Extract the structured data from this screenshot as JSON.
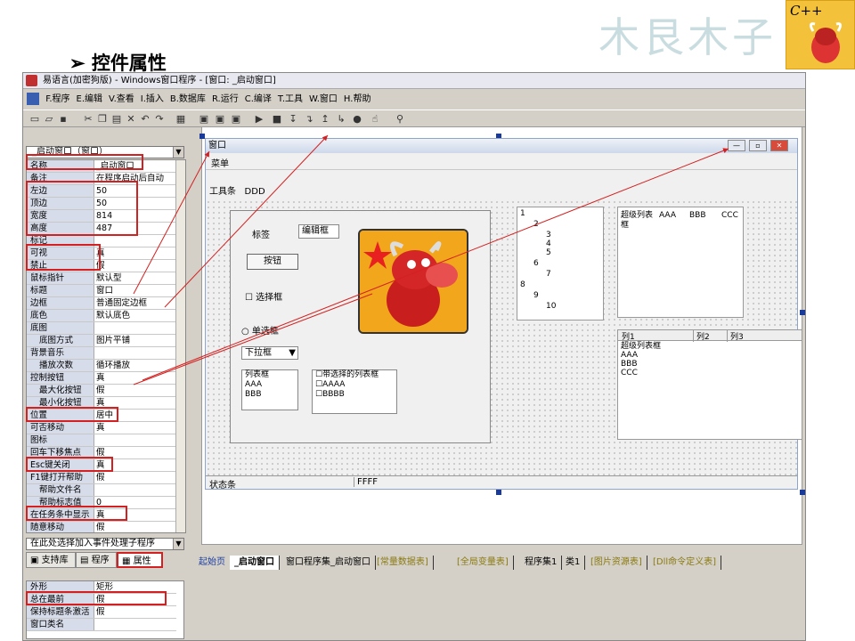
{
  "slide": {
    "bullet": "➢",
    "title": "控件属性",
    "brand": "木艮木子",
    "logo_text": "C++"
  },
  "app": {
    "title": "易语言(加密狗版) - Windows窗口程序 - [窗口: _启动窗口]",
    "menu": [
      "F.程序",
      "E.编辑",
      "V.查看",
      "I.插入",
      "B.数据库",
      "R.运行",
      "C.编译",
      "T.工具",
      "W.窗口",
      "H.帮助"
    ],
    "toolbar_icons": [
      "new-icon",
      "open-icon",
      "save-icon",
      "cut-icon",
      "copy-icon",
      "paste-icon",
      "delete-icon",
      "undo-icon",
      "redo-icon",
      "find-icon",
      "layout1-icon",
      "layout2-icon",
      "layout3-icon",
      "run-icon",
      "stop-icon",
      "step-icon",
      "step-into-icon",
      "step-out-icon",
      "run-to-icon",
      "breakpoint-icon",
      "hand-icon",
      "binoculars-icon"
    ]
  },
  "props": {
    "selector": "_启动窗口（窗口）",
    "rows": [
      {
        "k": "名称",
        "v": "_启动窗口"
      },
      {
        "k": "备注",
        "v": "在程序启动后自动"
      },
      {
        "k": "左边",
        "v": "50"
      },
      {
        "k": "顶边",
        "v": "50"
      },
      {
        "k": "宽度",
        "v": "814"
      },
      {
        "k": "高度",
        "v": "487"
      },
      {
        "k": "标记",
        "v": ""
      },
      {
        "k": "可视",
        "v": "真"
      },
      {
        "k": "禁止",
        "v": "假"
      },
      {
        "k": "鼠标指针",
        "v": "默认型"
      },
      {
        "k": "标题",
        "v": "窗口"
      },
      {
        "k": "边框",
        "v": "普通固定边框"
      },
      {
        "k": "底色",
        "v": "默认底色"
      },
      {
        "k": "底图",
        "v": ""
      },
      {
        "k": "底图方式",
        "v": "图片平铺",
        "sub": true
      },
      {
        "k": "背景音乐",
        "v": ""
      },
      {
        "k": "播放次数",
        "v": "循环播放",
        "sub": true
      },
      {
        "k": "控制按钮",
        "v": "真"
      },
      {
        "k": "最大化按钮",
        "v": "假",
        "sub": true
      },
      {
        "k": "最小化按钮",
        "v": "真",
        "sub": true
      },
      {
        "k": "位置",
        "v": "居中"
      },
      {
        "k": "可否移动",
        "v": "真"
      },
      {
        "k": "图标",
        "v": ""
      },
      {
        "k": "回车下移焦点",
        "v": "假"
      },
      {
        "k": "Esc键关闭",
        "v": "真"
      },
      {
        "k": "F1键打开帮助",
        "v": "假"
      },
      {
        "k": "帮助文件名",
        "v": "",
        "sub": true
      },
      {
        "k": "帮助标志值",
        "v": "0",
        "sub": true
      },
      {
        "k": "在任务条中显示",
        "v": "真"
      },
      {
        "k": "随意移动",
        "v": "假"
      }
    ],
    "event_box": "在此处选择加入事件处理子程序",
    "tabs": [
      "支持库",
      "程序",
      "属性"
    ],
    "bottom_rows": [
      {
        "k": "外形",
        "v": "矩形"
      },
      {
        "k": "总在最前",
        "v": "假"
      },
      {
        "k": "保持标题条激活",
        "v": "假"
      },
      {
        "k": "窗口类名",
        "v": ""
      }
    ]
  },
  "form": {
    "title": "窗口",
    "menu": "菜单",
    "toolbar_label": "工具条",
    "toolbar_value": "DDD",
    "label": "标签",
    "edit": "编辑框",
    "button": "按钮",
    "checkbox": "选择框",
    "radio": "单选框",
    "combo": "下拉框",
    "listbox": [
      "列表框",
      "AAA",
      "BBB"
    ],
    "checklist": [
      "带选择的列表框",
      "AAAA",
      "BBBB"
    ],
    "tree": [
      "1",
      "2",
      "3",
      "4",
      "5",
      "6",
      "7",
      "8",
      "9",
      "10"
    ],
    "superlist": {
      "header": [
        "超级列表框",
        "AAA",
        "BBB",
        "CCC"
      ]
    },
    "listview": {
      "columns": [
        "列1",
        "列2",
        "列3"
      ],
      "items": [
        "超级列表框",
        "AAA",
        "BBB",
        "CCC"
      ]
    },
    "statusbar": [
      "状态条",
      "FFFF"
    ]
  },
  "filetabs": [
    "起始页",
    "_启动窗口",
    "窗口程序集_启动窗口",
    "[常量数据表]",
    "[全局变量表]",
    "程序集1",
    "类1",
    "[图片资源表]",
    "[Dll命令定义表]"
  ],
  "colors": {
    "highlight": "#d42020",
    "accent": "#3a5fb0"
  }
}
